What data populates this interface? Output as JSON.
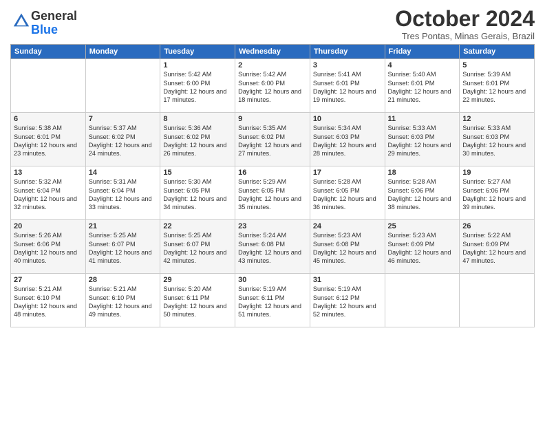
{
  "logo": {
    "general": "General",
    "blue": "Blue"
  },
  "header": {
    "month": "October 2024",
    "location": "Tres Pontas, Minas Gerais, Brazil"
  },
  "weekdays": [
    "Sunday",
    "Monday",
    "Tuesday",
    "Wednesday",
    "Thursday",
    "Friday",
    "Saturday"
  ],
  "weeks": [
    [
      {
        "day": "",
        "info": ""
      },
      {
        "day": "",
        "info": ""
      },
      {
        "day": "1",
        "info": "Sunrise: 5:42 AM\nSunset: 6:00 PM\nDaylight: 12 hours and 17 minutes."
      },
      {
        "day": "2",
        "info": "Sunrise: 5:42 AM\nSunset: 6:00 PM\nDaylight: 12 hours and 18 minutes."
      },
      {
        "day": "3",
        "info": "Sunrise: 5:41 AM\nSunset: 6:01 PM\nDaylight: 12 hours and 19 minutes."
      },
      {
        "day": "4",
        "info": "Sunrise: 5:40 AM\nSunset: 6:01 PM\nDaylight: 12 hours and 21 minutes."
      },
      {
        "day": "5",
        "info": "Sunrise: 5:39 AM\nSunset: 6:01 PM\nDaylight: 12 hours and 22 minutes."
      }
    ],
    [
      {
        "day": "6",
        "info": "Sunrise: 5:38 AM\nSunset: 6:01 PM\nDaylight: 12 hours and 23 minutes."
      },
      {
        "day": "7",
        "info": "Sunrise: 5:37 AM\nSunset: 6:02 PM\nDaylight: 12 hours and 24 minutes."
      },
      {
        "day": "8",
        "info": "Sunrise: 5:36 AM\nSunset: 6:02 PM\nDaylight: 12 hours and 26 minutes."
      },
      {
        "day": "9",
        "info": "Sunrise: 5:35 AM\nSunset: 6:02 PM\nDaylight: 12 hours and 27 minutes."
      },
      {
        "day": "10",
        "info": "Sunrise: 5:34 AM\nSunset: 6:03 PM\nDaylight: 12 hours and 28 minutes."
      },
      {
        "day": "11",
        "info": "Sunrise: 5:33 AM\nSunset: 6:03 PM\nDaylight: 12 hours and 29 minutes."
      },
      {
        "day": "12",
        "info": "Sunrise: 5:33 AM\nSunset: 6:03 PM\nDaylight: 12 hours and 30 minutes."
      }
    ],
    [
      {
        "day": "13",
        "info": "Sunrise: 5:32 AM\nSunset: 6:04 PM\nDaylight: 12 hours and 32 minutes."
      },
      {
        "day": "14",
        "info": "Sunrise: 5:31 AM\nSunset: 6:04 PM\nDaylight: 12 hours and 33 minutes."
      },
      {
        "day": "15",
        "info": "Sunrise: 5:30 AM\nSunset: 6:05 PM\nDaylight: 12 hours and 34 minutes."
      },
      {
        "day": "16",
        "info": "Sunrise: 5:29 AM\nSunset: 6:05 PM\nDaylight: 12 hours and 35 minutes."
      },
      {
        "day": "17",
        "info": "Sunrise: 5:28 AM\nSunset: 6:05 PM\nDaylight: 12 hours and 36 minutes."
      },
      {
        "day": "18",
        "info": "Sunrise: 5:28 AM\nSunset: 6:06 PM\nDaylight: 12 hours and 38 minutes."
      },
      {
        "day": "19",
        "info": "Sunrise: 5:27 AM\nSunset: 6:06 PM\nDaylight: 12 hours and 39 minutes."
      }
    ],
    [
      {
        "day": "20",
        "info": "Sunrise: 5:26 AM\nSunset: 6:06 PM\nDaylight: 12 hours and 40 minutes."
      },
      {
        "day": "21",
        "info": "Sunrise: 5:25 AM\nSunset: 6:07 PM\nDaylight: 12 hours and 41 minutes."
      },
      {
        "day": "22",
        "info": "Sunrise: 5:25 AM\nSunset: 6:07 PM\nDaylight: 12 hours and 42 minutes."
      },
      {
        "day": "23",
        "info": "Sunrise: 5:24 AM\nSunset: 6:08 PM\nDaylight: 12 hours and 43 minutes."
      },
      {
        "day": "24",
        "info": "Sunrise: 5:23 AM\nSunset: 6:08 PM\nDaylight: 12 hours and 45 minutes."
      },
      {
        "day": "25",
        "info": "Sunrise: 5:23 AM\nSunset: 6:09 PM\nDaylight: 12 hours and 46 minutes."
      },
      {
        "day": "26",
        "info": "Sunrise: 5:22 AM\nSunset: 6:09 PM\nDaylight: 12 hours and 47 minutes."
      }
    ],
    [
      {
        "day": "27",
        "info": "Sunrise: 5:21 AM\nSunset: 6:10 PM\nDaylight: 12 hours and 48 minutes."
      },
      {
        "day": "28",
        "info": "Sunrise: 5:21 AM\nSunset: 6:10 PM\nDaylight: 12 hours and 49 minutes."
      },
      {
        "day": "29",
        "info": "Sunrise: 5:20 AM\nSunset: 6:11 PM\nDaylight: 12 hours and 50 minutes."
      },
      {
        "day": "30",
        "info": "Sunrise: 5:19 AM\nSunset: 6:11 PM\nDaylight: 12 hours and 51 minutes."
      },
      {
        "day": "31",
        "info": "Sunrise: 5:19 AM\nSunset: 6:12 PM\nDaylight: 12 hours and 52 minutes."
      },
      {
        "day": "",
        "info": ""
      },
      {
        "day": "",
        "info": ""
      }
    ]
  ]
}
